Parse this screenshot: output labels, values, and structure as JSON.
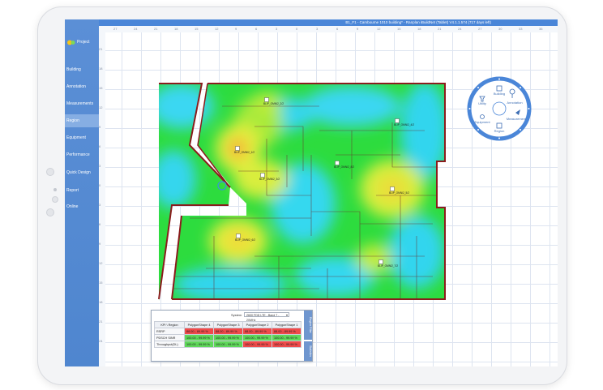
{
  "app": {
    "title": "B1_F1 - Cambourne 1010 building* - Ranplan iBuildNet (Tablet) V4.1.1.574 (717 days left)"
  },
  "sidebar": {
    "project_label": "Project",
    "items": [
      {
        "label": "Building",
        "active": false
      },
      {
        "label": "Annotation",
        "active": false
      },
      {
        "label": "Measurements",
        "active": false
      },
      {
        "label": "Region",
        "active": true
      },
      {
        "label": "Equipment",
        "active": false
      },
      {
        "label": "Performance",
        "active": false
      },
      {
        "label": "Quick Design",
        "active": false
      },
      {
        "label": "Report",
        "active": false
      },
      {
        "label": "Online",
        "active": false
      }
    ]
  },
  "ruler": {
    "top": [
      "27",
      "24",
      "21",
      "18",
      "15",
      "12",
      "9",
      "6",
      "3",
      "0",
      "3",
      "6",
      "9",
      "12",
      "15",
      "18",
      "21",
      "24",
      "27",
      "30",
      "33",
      "36"
    ],
    "left": [
      "21",
      "18",
      "15",
      "12",
      "9",
      "6",
      "3",
      "0",
      "3",
      "6",
      "9",
      "12",
      "15",
      "18",
      "21",
      "24"
    ]
  },
  "radial_menu": {
    "items": [
      "Building",
      "Annotation",
      "Measurement",
      "Region",
      "Equipment",
      "Utility"
    ],
    "accent": "#4a86d8"
  },
  "map_labels": [
    "BLIP_OMNI2_1/2",
    "BLIP_OMNI2_2/2",
    "BLIP_OMNI2_3/2",
    "BLIP_OMNI2_4/2",
    "BLIP_OMNI2_5/2",
    "BLIP_OMNI2_6/2",
    "BLIP_OMNI2_7/2",
    "BLIP_OMNI2_8/2"
  ],
  "kpi_panel": {
    "system_label": "System",
    "system_value": "2600 FDD LTE - Band 7 - 20MHz",
    "side_tabs": [
      "Region Filter",
      "Statistics"
    ],
    "columns": [
      "KPI \\ Region",
      "PolygonShape 4",
      "PolygonShape 3",
      "PolygonShape 2",
      "PolygonShape 1"
    ],
    "rows": [
      {
        "name": "RSRP",
        "cells": [
          "88.00 - 89.99 %",
          "88.00 - 89.99 %",
          "88.00 - 89.99 %",
          "88.00 - 89.99 %"
        ],
        "status": [
          "bad",
          "bad",
          "bad",
          "bad"
        ]
      },
      {
        "name": "PDSCH SINR",
        "cells": [
          "100.00 - 99.99 %",
          "100.00 - 99.99 %",
          "100.00 - 99.99 %",
          "100.00 - 99.99 %"
        ],
        "status": [
          "good",
          "good",
          "good",
          "good"
        ]
      },
      {
        "name": "Throughput(DL)",
        "cells": [
          "100.00 - 99.99 %",
          "100.00 - 99.99 %",
          "100.00 - 99.99 %",
          "100.00 - 99.99 %"
        ],
        "status": [
          "good",
          "good",
          "bad",
          "bad"
        ]
      }
    ],
    "colors": {
      "good": "#5fd85a",
      "bad": "#ef4a4a"
    }
  }
}
